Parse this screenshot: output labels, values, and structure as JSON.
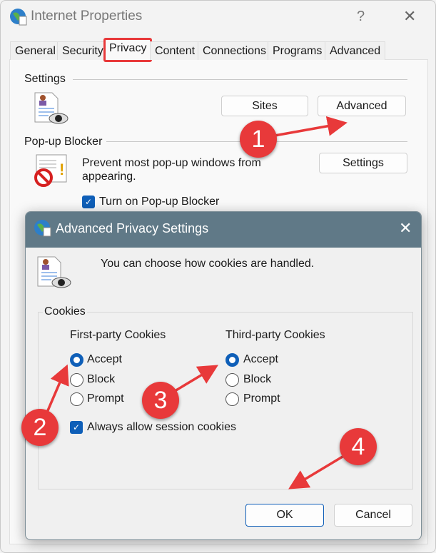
{
  "window": {
    "title": "Internet Properties",
    "help": "?",
    "close": "✕"
  },
  "tabs": [
    {
      "label": "General"
    },
    {
      "label": "Security"
    },
    {
      "label": "Privacy",
      "active": true
    },
    {
      "label": "Content"
    },
    {
      "label": "Connections"
    },
    {
      "label": "Programs"
    },
    {
      "label": "Advanced"
    }
  ],
  "settings": {
    "heading": "Settings",
    "sites": "Sites",
    "advanced": "Advanced"
  },
  "popup": {
    "heading": "Pop-up Blocker",
    "description_line1": "Prevent most pop-up windows from",
    "description_line2": "appearing.",
    "settings": "Settings",
    "checkbox": "Turn on Pop-up Blocker",
    "checked": true
  },
  "dialog": {
    "title": "Advanced Privacy Settings",
    "close": "✕",
    "intro": "You can choose how cookies are handled.",
    "group": "Cookies",
    "first_party": {
      "label": "First-party Cookies",
      "options": [
        "Accept",
        "Block",
        "Prompt"
      ],
      "selected": "Accept"
    },
    "third_party": {
      "label": "Third-party Cookies",
      "options": [
        "Accept",
        "Block",
        "Prompt"
      ],
      "selected": "Accept"
    },
    "session": {
      "label": "Always allow session cookies",
      "checked": true
    },
    "ok": "OK",
    "cancel": "Cancel"
  },
  "annotations": {
    "color": "#e8393a",
    "steps": [
      "1",
      "2",
      "3",
      "4"
    ]
  },
  "colors": {
    "accent": "#0f5fb8",
    "dialog_titlebar": "#607987",
    "highlight": "#e8393a"
  }
}
